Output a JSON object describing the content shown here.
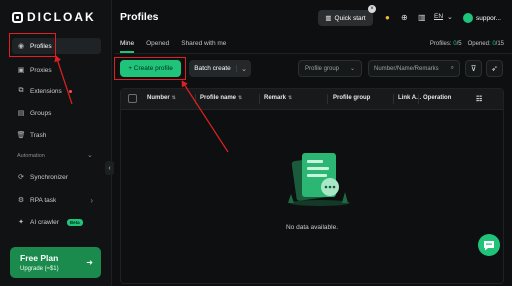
{
  "brand": {
    "name": "DICLOAK"
  },
  "sidebar": {
    "items": [
      {
        "label": "Profiles",
        "icon": "profiles-icon"
      },
      {
        "label": "Proxies",
        "icon": "proxy-icon"
      },
      {
        "label": "Extensions",
        "icon": "extensions-icon"
      },
      {
        "label": "Groups",
        "icon": "groups-icon"
      },
      {
        "label": "Trash",
        "icon": "trash-icon"
      }
    ],
    "section": "Automation",
    "auto_items": [
      {
        "label": "Synchronizer",
        "icon": "sync-icon"
      },
      {
        "label": "RPA task",
        "icon": "rpa-icon"
      },
      {
        "label": "AI crawler",
        "icon": "ai-icon",
        "badge": "Beta"
      }
    ],
    "plan": {
      "title": "Free Plan",
      "upgrade": "Upgrade (≈$1)"
    }
  },
  "header": {
    "title": "Profiles",
    "quick_start": "Quick start",
    "lang": "EN",
    "user": "suppor..."
  },
  "tabs": [
    {
      "label": "Mine",
      "active": true
    },
    {
      "label": "Opened"
    },
    {
      "label": "Shared with me"
    }
  ],
  "counts": {
    "profiles_label": "Profiles:",
    "profiles_value": "0",
    "profiles_total": "/5",
    "opened_label": "Opened:",
    "opened_value": "0",
    "opened_total": "/15"
  },
  "toolbar": {
    "create": "+ Create profile",
    "batch": "Batch create",
    "group_select": "Profile group",
    "search_placeholder": "Number/Name/Remarks"
  },
  "table": {
    "columns": [
      "Number",
      "Profile name",
      "Remark",
      "Profile group",
      "Link A...",
      "Operation"
    ],
    "empty": "No data available."
  },
  "colors": {
    "accent": "#1fc37a",
    "highlight": "#e02020",
    "bg": "#0d0f10"
  }
}
